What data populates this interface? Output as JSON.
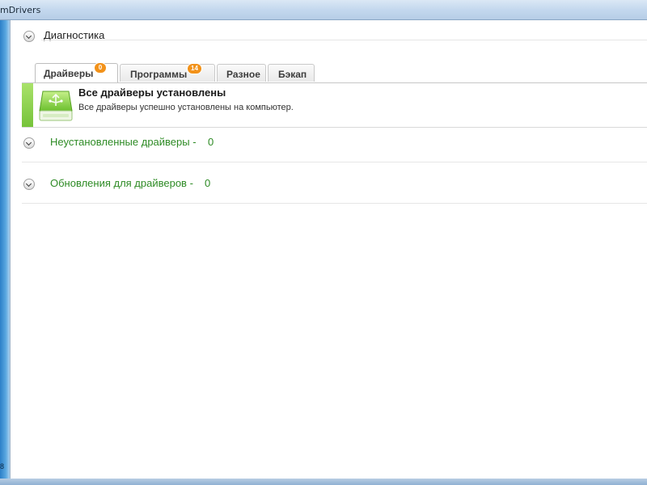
{
  "window": {
    "title": "mDrivers"
  },
  "left_frame_glyph": "8",
  "diagnostics": {
    "title": "Диагностика"
  },
  "tabs": [
    {
      "label": "Драйверы",
      "badge": "0",
      "active": true
    },
    {
      "label": "Программы",
      "badge": "14",
      "active": false
    },
    {
      "label": "Разное",
      "badge": "",
      "active": false
    },
    {
      "label": "Бэкап",
      "badge": "",
      "active": false
    }
  ],
  "status": {
    "title": "Все драйверы установлены",
    "description": "Все драйверы успешно установлены на компьютер.",
    "icon": "green-drive-icon",
    "accent_color": "#76c33a"
  },
  "groups": [
    {
      "label": "Неустановленные драйверы -",
      "count": "0"
    },
    {
      "label": "Обновления для драйверов -",
      "count": "0"
    }
  ],
  "colors": {
    "group_label": "#2e8b25",
    "badge": "#f2921a",
    "titlebar": "#c4d8ee"
  }
}
